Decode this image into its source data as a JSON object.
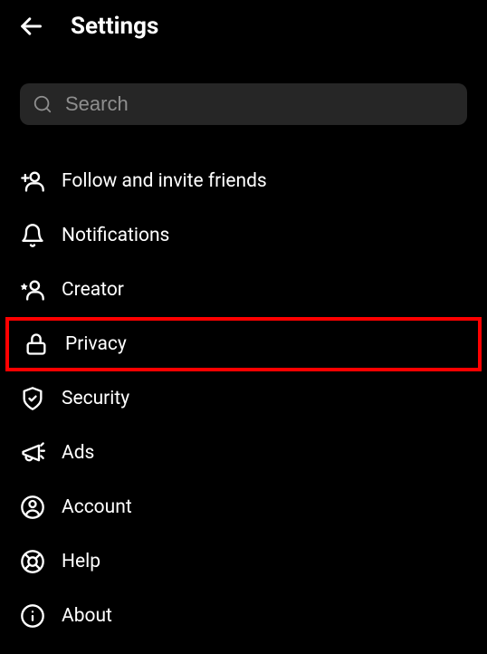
{
  "header": {
    "title": "Settings"
  },
  "search": {
    "placeholder": "Search"
  },
  "menu": {
    "items": [
      {
        "label": "Follow and invite friends",
        "icon": "add-person-icon",
        "highlighted": false
      },
      {
        "label": "Notifications",
        "icon": "bell-icon",
        "highlighted": false
      },
      {
        "label": "Creator",
        "icon": "star-person-icon",
        "highlighted": false
      },
      {
        "label": "Privacy",
        "icon": "lock-icon",
        "highlighted": true
      },
      {
        "label": "Security",
        "icon": "shield-icon",
        "highlighted": false
      },
      {
        "label": "Ads",
        "icon": "megaphone-icon",
        "highlighted": false
      },
      {
        "label": "Account",
        "icon": "account-icon",
        "highlighted": false
      },
      {
        "label": "Help",
        "icon": "lifebuoy-icon",
        "highlighted": false
      },
      {
        "label": "About",
        "icon": "info-icon",
        "highlighted": false
      }
    ]
  }
}
